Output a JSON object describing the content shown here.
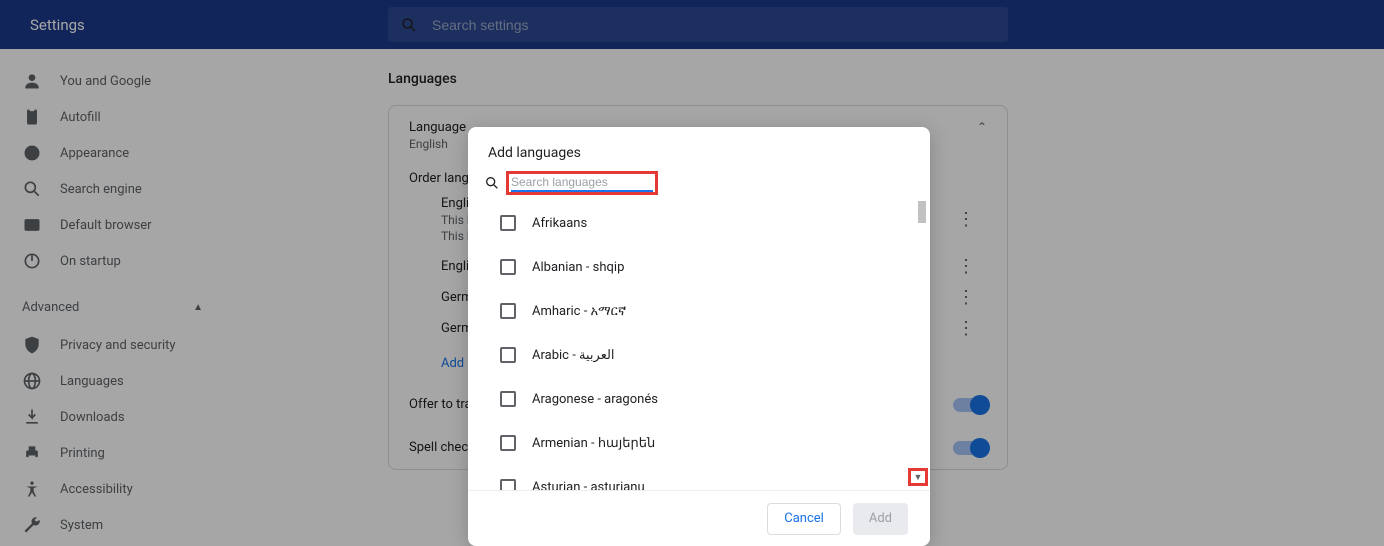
{
  "topbar": {
    "title": "Settings",
    "search_placeholder": "Search settings"
  },
  "sidebar": {
    "items_top": [
      {
        "label": "You and Google",
        "icon": "person"
      },
      {
        "label": "Autofill",
        "icon": "clipboard"
      },
      {
        "label": "Appearance",
        "icon": "palette"
      },
      {
        "label": "Search engine",
        "icon": "search"
      },
      {
        "label": "Default browser",
        "icon": "browser"
      },
      {
        "label": "On startup",
        "icon": "power"
      }
    ],
    "advanced_label": "Advanced",
    "items_advanced": [
      {
        "label": "Privacy and security",
        "icon": "shield"
      },
      {
        "label": "Languages",
        "icon": "globe"
      },
      {
        "label": "Downloads",
        "icon": "download"
      },
      {
        "label": "Printing",
        "icon": "printer"
      },
      {
        "label": "Accessibility",
        "icon": "accessibility"
      },
      {
        "label": "System",
        "icon": "wrench"
      }
    ]
  },
  "main": {
    "heading": "Languages",
    "language_section": {
      "title": "Language",
      "subtitle": "English",
      "order_label": "Order languages based on your preference",
      "rows": [
        {
          "name": "English (United States)",
          "line1": "This language is used to display the Google Chrome UI",
          "line2": "This language is used when translating pages"
        },
        {
          "name": "English"
        },
        {
          "name": "German"
        },
        {
          "name": "German (Germany)"
        }
      ],
      "add_link": "Add languages"
    },
    "offer_translate": "Offer to translate pages that aren't in a language you read",
    "spell_check": "Spell check"
  },
  "modal": {
    "title": "Add languages",
    "search_placeholder": "Search languages",
    "items": [
      "Afrikaans",
      "Albanian - shqip",
      "Amharic - አማርኛ",
      "Arabic - العربية",
      "Aragonese - aragonés",
      "Armenian - հայերեն",
      "Asturian - asturianu"
    ],
    "cancel": "Cancel",
    "add": "Add"
  }
}
